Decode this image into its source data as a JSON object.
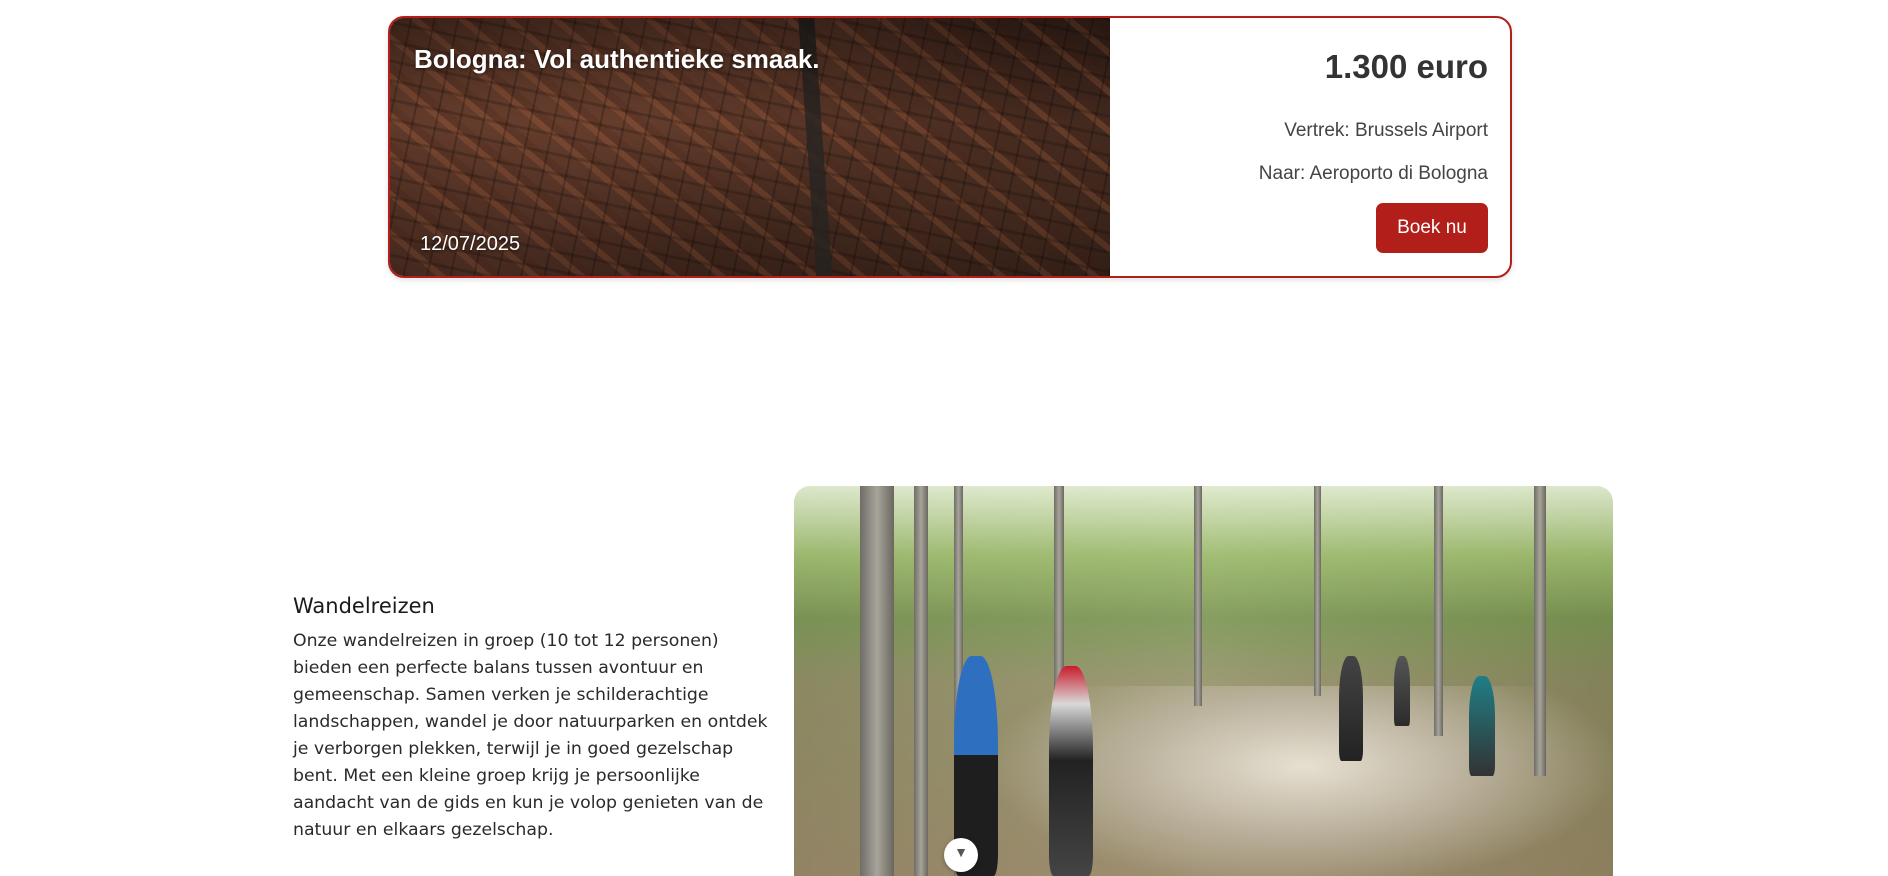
{
  "trip": {
    "title": "Bologna: Vol authentieke smaak.",
    "date": "12/07/2025",
    "price": "1.300 euro",
    "departure": "Vertrek: Brussels Airport",
    "destination": "Naar: Aeroporto di Bologna",
    "book_label": "Boek nu"
  },
  "hiking": {
    "heading": "Wandelreizen",
    "body": "Onze wandelreizen in groep (10 tot 12 personen) bieden een perfecte balans tussen avontuur en gemeenschap. Samen verken je schilderachtige landschappen, wandel je door natuurparken en ontdek je verborgen plekken, terwijl je in goed gezelschap bent. Met een kleine groep krijg je persoonlijke aandacht van de gids en kun je volop genieten van de natuur en elkaars gezelschap."
  },
  "colors": {
    "accent": "#b21f1b",
    "text": "#333333"
  },
  "icons": {
    "scroll": "chevron-down-icon"
  }
}
